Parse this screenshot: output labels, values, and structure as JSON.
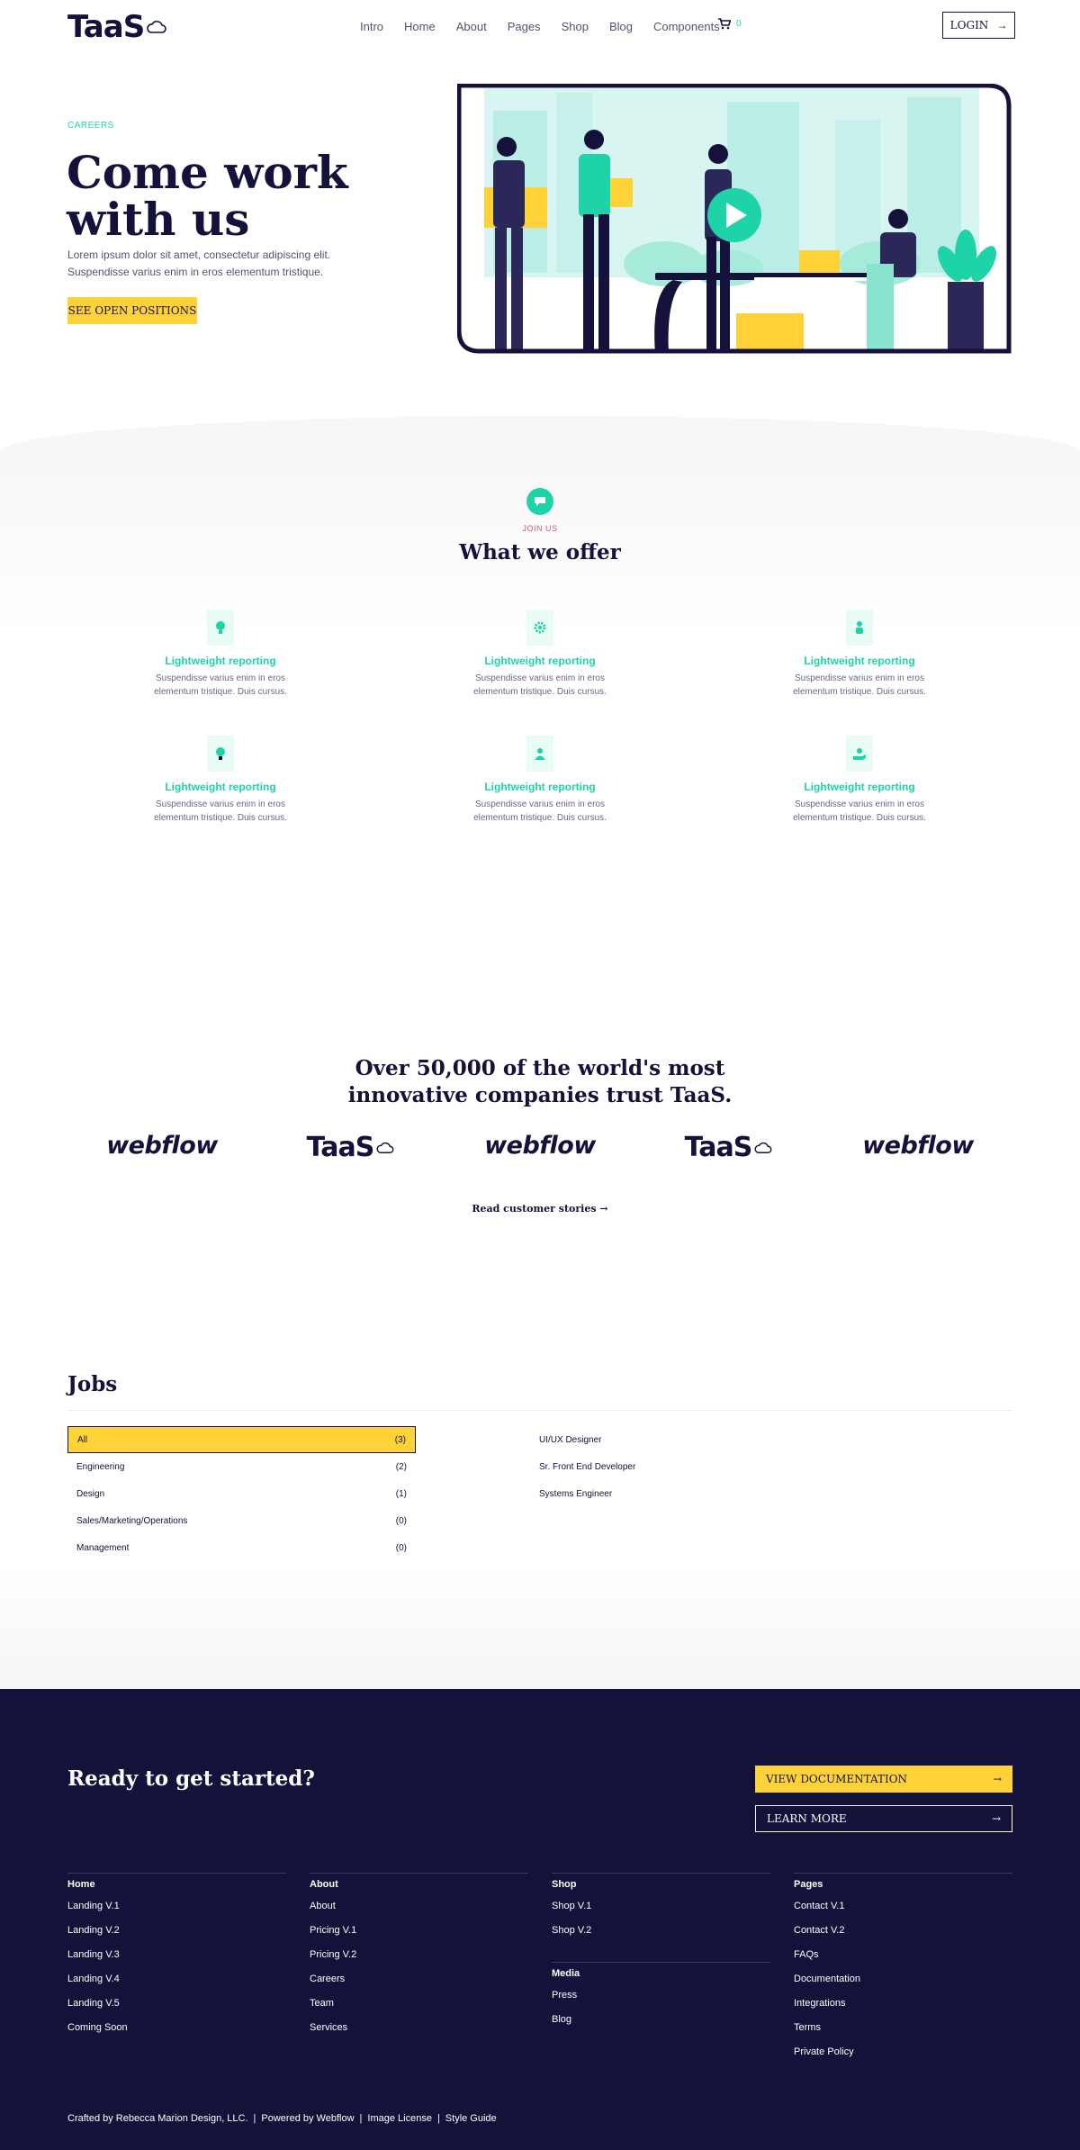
{
  "header": {
    "logo_text": "TaaS",
    "nav": [
      "Intro",
      "Home",
      "About",
      "Pages",
      "Shop",
      "Blog",
      "Components"
    ],
    "cart_count": "0",
    "login_label": "LOGIN"
  },
  "hero": {
    "eyebrow": "CAREERS",
    "title": "Come work with us",
    "text": "Lorem ipsum dolor sit amet, consectetur adipiscing elit. Suspendisse varius enim in eros elementum tristique.",
    "button_label": "SEE OPEN POSITIONS"
  },
  "offer": {
    "eyebrow": "JOIN US",
    "title": "What we offer",
    "features": [
      {
        "icon": "lightbulb-icon",
        "title": "Lightweight reporting",
        "text": "Suspendisse varius enim in eros elementum tristique. Duis cursus."
      },
      {
        "icon": "gear-icon",
        "title": "Lightweight reporting",
        "text": "Suspendisse varius enim in eros elementum tristique. Duis cursus."
      },
      {
        "icon": "hand-icon",
        "title": "Lightweight reporting",
        "text": "Suspendisse varius enim in eros elementum tristique. Duis cursus."
      },
      {
        "icon": "bulb-icon",
        "title": "Lightweight reporting",
        "text": "Suspendisse varius enim in eros elementum tristique. Duis cursus."
      },
      {
        "icon": "person-icon",
        "title": "Lightweight reporting",
        "text": "Suspendisse varius enim in eros elementum tristique. Duis cursus."
      },
      {
        "icon": "hand-money-icon",
        "title": "Lightweight reporting",
        "text": "Suspendisse varius enim in eros elementum tristique. Duis cursus."
      }
    ]
  },
  "trust": {
    "title": "Over 50,000 of the world's most innovative companies trust TaaS.",
    "logos": [
      "webflow",
      "TaaS",
      "webflow",
      "TaaS",
      "webflow"
    ],
    "stories_link": "Read customer stories"
  },
  "jobs": {
    "title": "Jobs",
    "categories": [
      {
        "name": "All",
        "count": "(3)",
        "active": true
      },
      {
        "name": "Engineering",
        "count": "(2)"
      },
      {
        "name": "Design",
        "count": "(1)"
      },
      {
        "name": "Sales/Marketing/Operations",
        "count": "(0)"
      },
      {
        "name": "Management",
        "count": "(0)"
      }
    ],
    "listings": [
      "UI/UX Designer",
      "Sr. Front End Developer",
      "Systems Engineer"
    ]
  },
  "footer": {
    "cta_title": "Ready to get started?",
    "doc_button": "VIEW DOCUMENTATION",
    "learn_button": "LEARN MORE",
    "columns": {
      "home": {
        "head": "Home",
        "items": [
          "Landing V.1",
          "Landing V.2",
          "Landing V.3",
          "Landing V.4",
          "Landing V.5",
          "Coming Soon"
        ]
      },
      "about": {
        "head": "About",
        "items": [
          "About",
          "Pricing V.1",
          "Pricing V.2",
          "Careers",
          "Team",
          "Services"
        ]
      },
      "shop": {
        "head": "Shop",
        "items": [
          "Shop V.1",
          "Shop V.2"
        ]
      },
      "media": {
        "head": "Media",
        "items": [
          "Press",
          "Blog"
        ]
      },
      "pages": {
        "head": "Pages",
        "items": [
          "Contact V.1",
          "Contact V.2",
          "FAQs",
          "Documentation",
          "Integrations",
          "Terms",
          "Private Policy"
        ]
      }
    },
    "credits": [
      "Crafted by Rebecca Marion Design, LLC.",
      "|",
      "Powered by Webflow",
      "|",
      "Image License",
      "|",
      "Style Guide"
    ]
  },
  "colors": {
    "navy": "#14113a",
    "teal": "#1ed3a8",
    "yellow": "#ffd338"
  }
}
